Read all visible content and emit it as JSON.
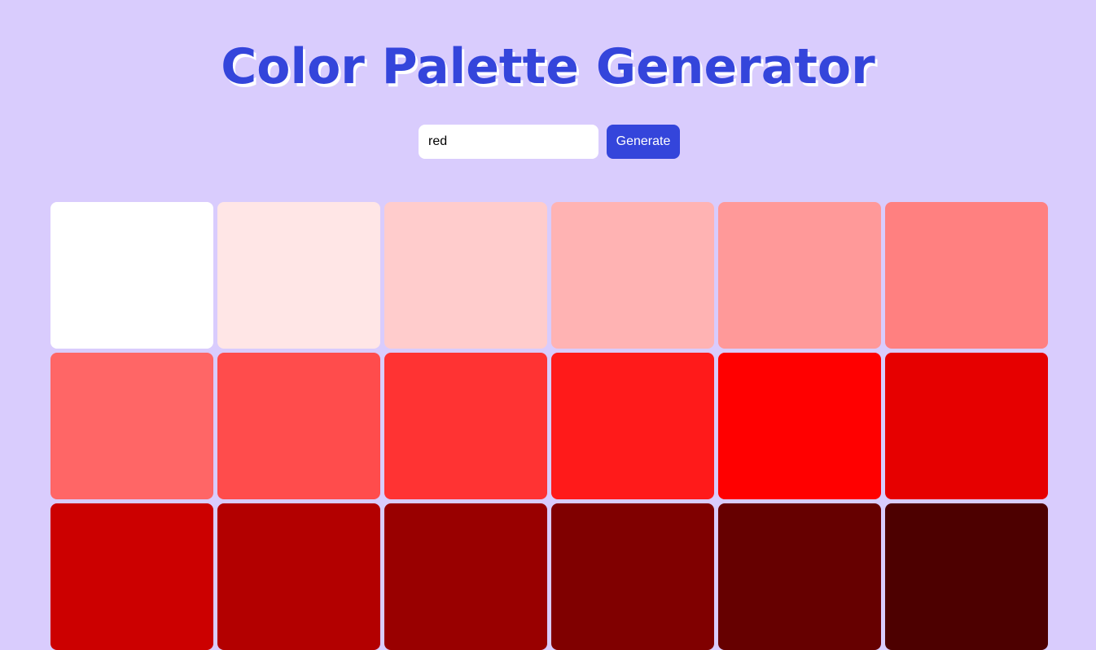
{
  "header": {
    "title": "Color Palette Generator"
  },
  "controls": {
    "input_value": "red",
    "generate_label": "Generate"
  },
  "palette": {
    "swatches": [
      "#ffffff",
      "#ffe6e6",
      "#ffcccc",
      "#ffb3b3",
      "#ff9999",
      "#ff8080",
      "#ff6666",
      "#ff4c4c",
      "#ff3333",
      "#ff1a1a",
      "#ff0000",
      "#e60000",
      "#cc0000",
      "#b30000",
      "#990000",
      "#800000",
      "#660000",
      "#4d0000"
    ]
  }
}
